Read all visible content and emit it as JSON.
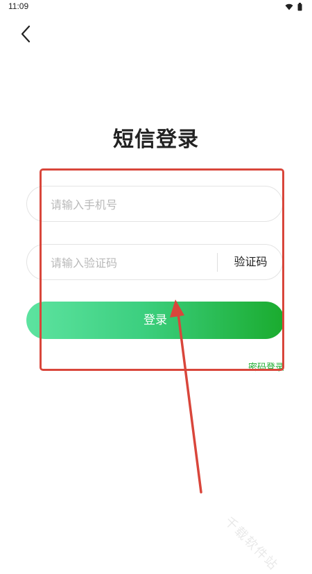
{
  "status_bar": {
    "time": "11:09"
  },
  "nav": {
    "back_icon": "chevron-left-icon"
  },
  "page": {
    "title": "短信登录"
  },
  "form": {
    "phone_placeholder": "请输入手机号",
    "code_placeholder": "请输入验证码",
    "code_button_label": "验证码",
    "login_button_label": "登录",
    "password_login_link": "密码登录"
  },
  "colors": {
    "accent_green": "#1aab2e",
    "gradient_start": "#5de3a0",
    "annotation_red": "#d9463b"
  },
  "watermark": {
    "text": "千载软件站"
  }
}
